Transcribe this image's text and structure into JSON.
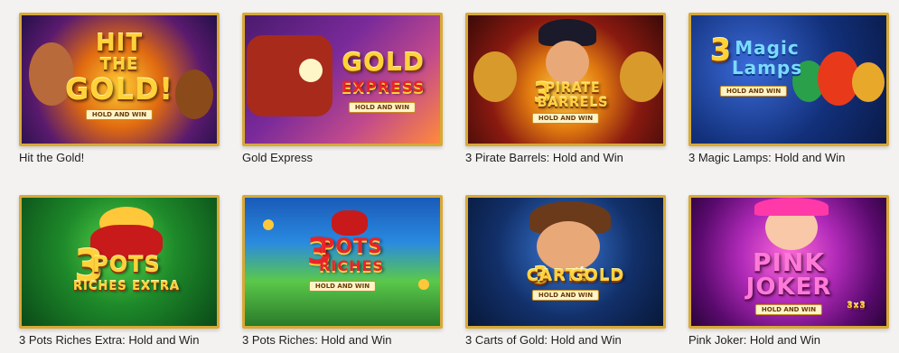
{
  "games": [
    {
      "title": "Hit the Gold!",
      "logo_lines": [
        "HIT",
        "THE",
        "GOLD!"
      ],
      "badge": "HOLD AND WIN"
    },
    {
      "title": "Gold Express",
      "logo_lines": [
        "GOLD",
        "EXPRESS"
      ],
      "badge": "HOLD AND WIN"
    },
    {
      "title": "3 Pirate Barrels: Hold and Win",
      "logo_lines": [
        "3",
        "PIRATE",
        "BARRELS"
      ],
      "badge": "HOLD AND WIN"
    },
    {
      "title": "3 Magic Lamps: Hold and Win",
      "logo_lines": [
        "3",
        "Magic",
        "Lamps"
      ],
      "badge": "HOLD AND WIN"
    },
    {
      "title": "3 Pots Riches Extra: Hold and Win",
      "logo_lines": [
        "3",
        "POTS",
        "RICHES EXTRA"
      ],
      "badge": ""
    },
    {
      "title": "3 Pots Riches: Hold and Win",
      "logo_lines": [
        "3",
        "POTS",
        "RICHES"
      ],
      "badge": "HOLD AND WIN"
    },
    {
      "title": "3 Carts of Gold: Hold and Win",
      "logo_lines": [
        "3",
        "CARTS",
        "of",
        "GOLD"
      ],
      "badge": "HOLD AND WIN"
    },
    {
      "title": "Pink Joker: Hold and Win",
      "logo_lines": [
        "PINK",
        "JOKER"
      ],
      "badge": "HOLD AND WIN",
      "extra": "3x3"
    }
  ]
}
